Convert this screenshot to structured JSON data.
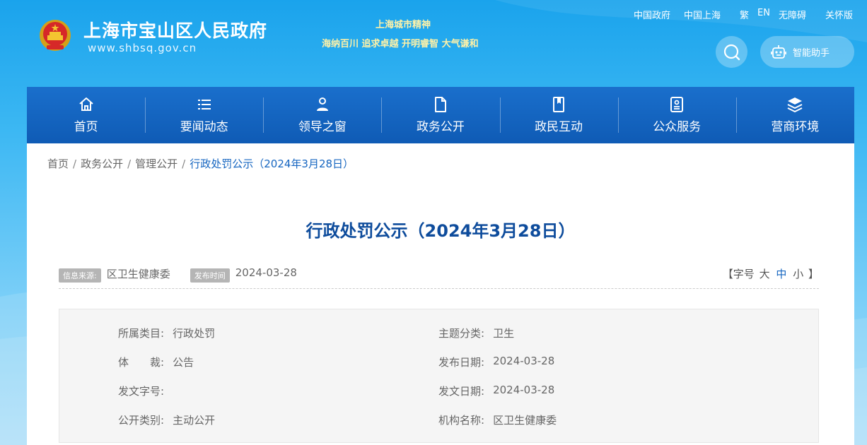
{
  "header": {
    "site_title": "上海市宝山区人民政府",
    "site_url": "www.shbsq.gov.cn",
    "spirit_title": "上海城市精神",
    "spirit_text": "海纳百川 追求卓越 开明睿智 大气谦和",
    "top_links": [
      "中国政府",
      "中国上海",
      "繁",
      "EN",
      "无障碍",
      "关怀版"
    ],
    "assistant_label": "智能助手"
  },
  "nav": {
    "items": [
      {
        "label": "首页",
        "icon": "home-icon"
      },
      {
        "label": "要闻动态",
        "icon": "list-icon"
      },
      {
        "label": "领导之窗",
        "icon": "person-icon"
      },
      {
        "label": "政务公开",
        "icon": "document-icon"
      },
      {
        "label": "政民互动",
        "icon": "book-icon"
      },
      {
        "label": "公众服务",
        "icon": "service-icon"
      },
      {
        "label": "营商环境",
        "icon": "layers-icon"
      }
    ]
  },
  "breadcrumb": [
    "首页",
    "政务公开",
    "管理公开",
    "行政处罚公示（2024年3月28日）"
  ],
  "article": {
    "title": "行政处罚公示（2024年3月28日）",
    "source_tag": "信息来源:",
    "source": "区卫生健康委",
    "date_tag": "发布时间",
    "date": "2024-03-28",
    "font_size_label_open": "【字号",
    "font_sizes": [
      "大",
      "中",
      "小"
    ],
    "font_size_label_close": "】"
  },
  "info": {
    "category_label": "所属类目:",
    "category": "行政处罚",
    "topic_label": "主题分类:",
    "topic": "卫生",
    "genre_label": "体　　裁:",
    "genre": "公告",
    "pub_date_label": "发布日期:",
    "pub_date": "2024-03-28",
    "doc_no_label": "发文字号:",
    "doc_no": "",
    "doc_date_label": "发文日期:",
    "doc_date": "2024-03-28",
    "open_type_label": "公开类别:",
    "open_type": "主动公开",
    "org_label": "机构名称:",
    "org": "区卫生健康委"
  },
  "colors": {
    "nav_bg": "#1565c0",
    "title_blue": "#0e4c9c",
    "slogan_yellow": "#fff2a8"
  }
}
